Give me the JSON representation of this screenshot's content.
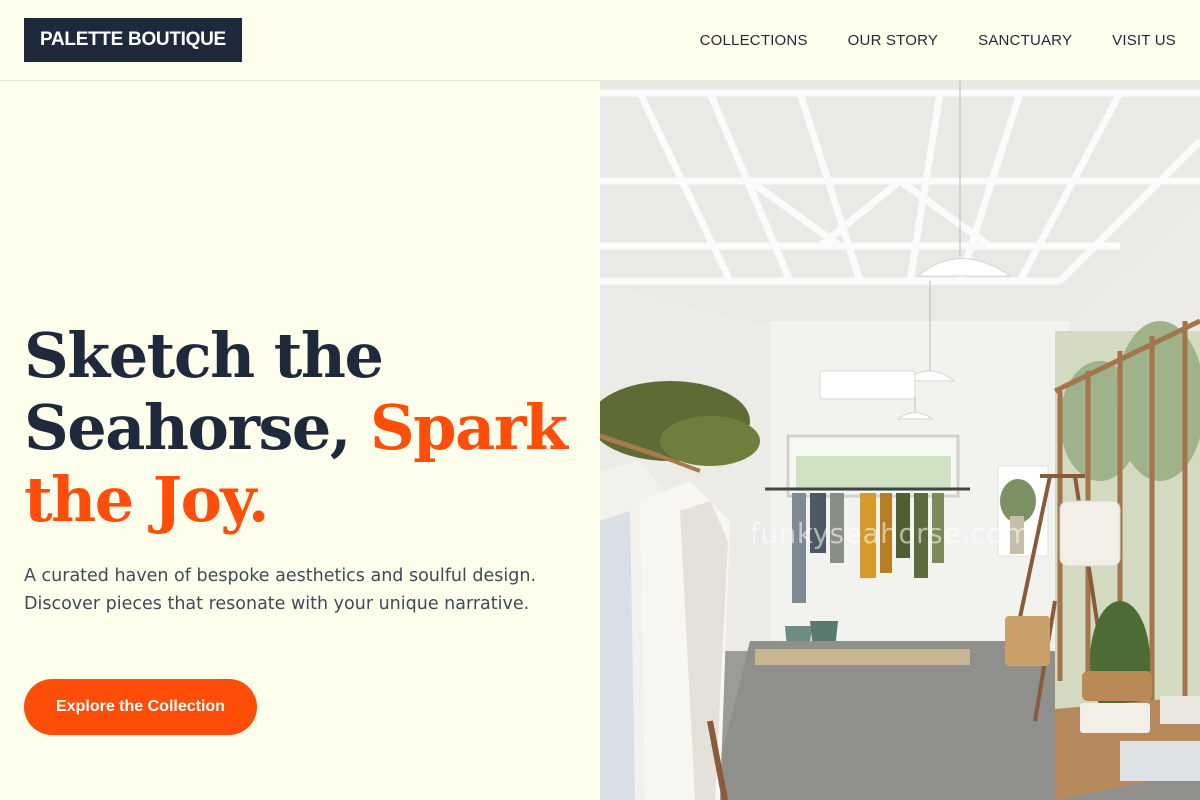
{
  "brand": {
    "name": "PALETTE BOUTIQUE"
  },
  "nav": {
    "items": [
      {
        "label": "COLLECTIONS"
      },
      {
        "label": "OUR STORY"
      },
      {
        "label": "SANCTUARY"
      },
      {
        "label": "VISIT US"
      }
    ]
  },
  "hero": {
    "headline_part1": "Sketch the Seahorse, ",
    "headline_accent": "Spark the Joy.",
    "subtitle": "A curated haven of bespoke aesthetics and soulful design. Discover pieces that resonate with your unique narrative.",
    "cta_label": "Explore the Collection"
  },
  "image": {
    "subject": "boutique-interior-photo",
    "watermark": "funkyseahorse.com"
  },
  "colors": {
    "background": "#fefeec",
    "navy": "#1e293b",
    "accent": "#ff4d0a",
    "body_text": "#3f4a5c"
  }
}
